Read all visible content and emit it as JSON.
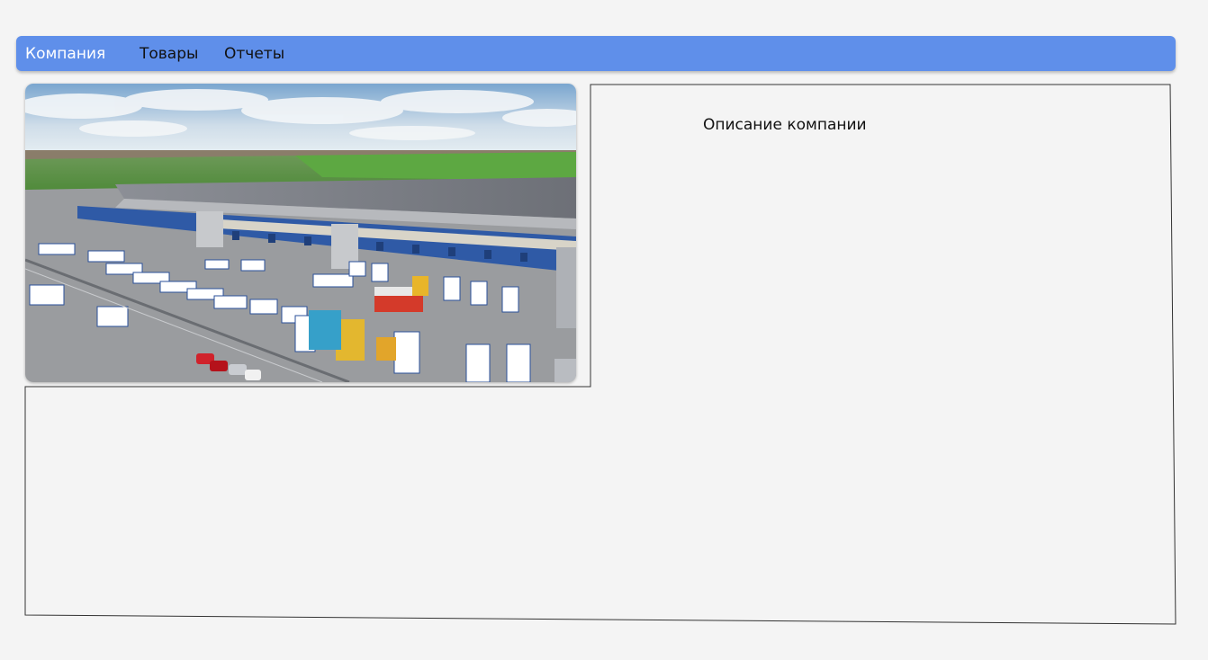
{
  "nav": {
    "items": [
      {
        "label": "Компания",
        "active": true
      },
      {
        "label": "Товары",
        "active": false
      },
      {
        "label": "Отчеты",
        "active": false
      }
    ]
  },
  "main": {
    "description_heading": "Описание компании"
  },
  "colors": {
    "navbar": "#5f8fea",
    "background": "#f4f4f4",
    "frame_line": "#333333"
  }
}
